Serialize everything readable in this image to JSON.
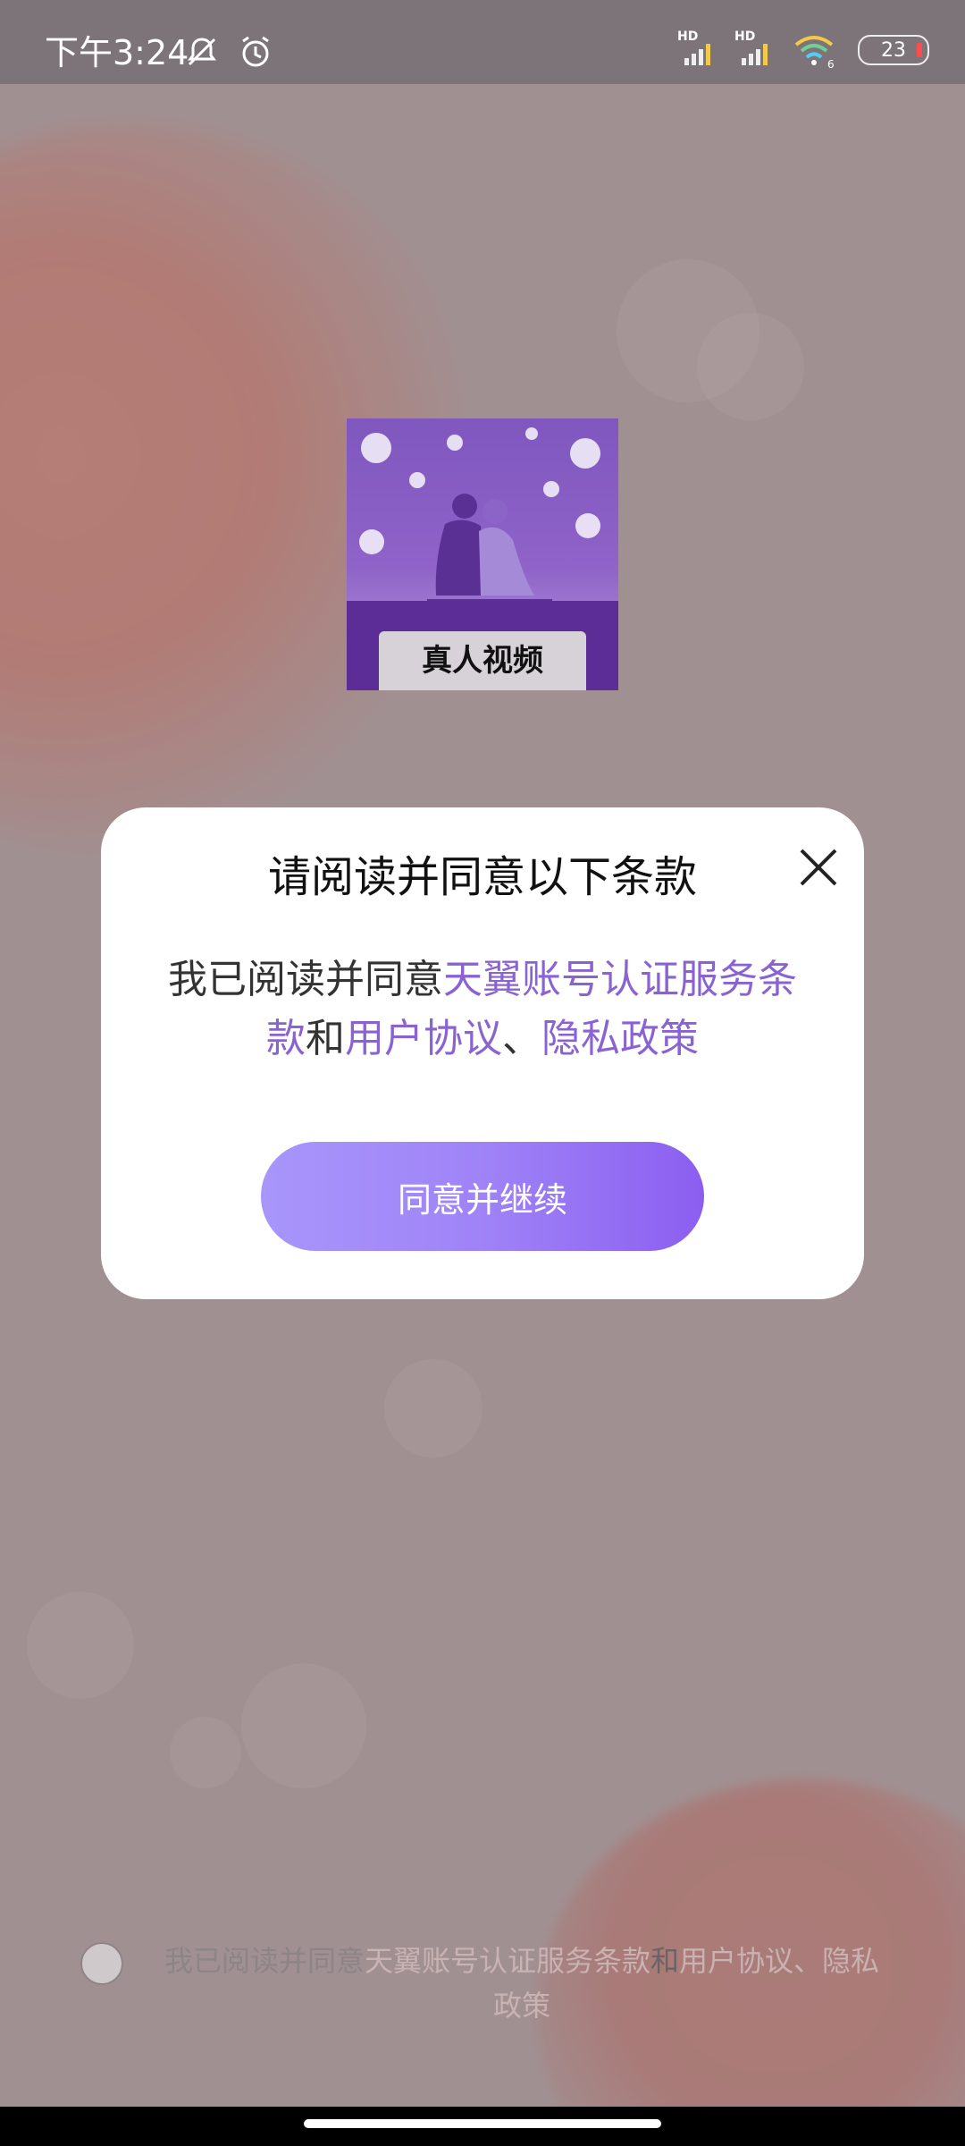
{
  "status_bar": {
    "time": "下午3:24",
    "icons": [
      "mute-icon",
      "alarm-icon"
    ],
    "signal_1": "HD",
    "signal_2": "HD",
    "wifi_label": "6",
    "battery": "23"
  },
  "app_logo": {
    "caption": "真人视频"
  },
  "dialog": {
    "title": "请阅读并同意以下条款",
    "body_prefix": "我已阅读并同意",
    "link_service": "天翼账号认证服务条款",
    "conj_and": "和",
    "link_user_agreement": "用户协议",
    "separator": "、",
    "link_privacy": "隐私政策",
    "agree_button": "同意并继续",
    "link_color": "#8a63d2"
  },
  "bottom_agreement": {
    "prefix": "我已阅读并同意",
    "link_service": "天翼账号认证服务条款",
    "conj_and": "和",
    "link_user_agreement": "用户协议",
    "separator": "、",
    "link_privacy_1": "隐私",
    "link_privacy_2": "政策"
  }
}
